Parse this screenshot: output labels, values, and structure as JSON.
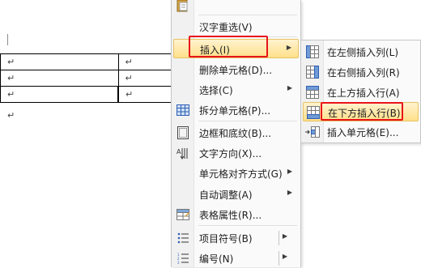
{
  "document": {
    "paragraph_mark": "↵",
    "rows": [
      [
        "↵",
        "↵"
      ],
      [
        "↵",
        "↵"
      ],
      [
        "↵",
        "↵"
      ]
    ],
    "after_table_mark": "↵"
  },
  "context_menu": {
    "items": [
      {
        "label": "",
        "icon": "paste-icon"
      },
      {
        "label": "汉字重选(V)",
        "icon": ""
      },
      {
        "label": "插入(I)",
        "icon": "",
        "submenu": true,
        "highlighted": true
      },
      {
        "label": "删除单元格(D)...",
        "icon": ""
      },
      {
        "label": "选择(C)",
        "icon": "",
        "submenu": true
      },
      {
        "label": "拆分单元格(P)...",
        "icon": "split-cells-icon"
      },
      {
        "label": "边框和底纹(B)...",
        "icon": "borders-icon"
      },
      {
        "label": "文字方向(X)...",
        "icon": "text-direction-icon"
      },
      {
        "label": "单元格对齐方式(G)",
        "icon": "",
        "submenu": true
      },
      {
        "label": "自动调整(A)",
        "icon": "",
        "submenu": true
      },
      {
        "label": "表格属性(R)...",
        "icon": "table-properties-icon"
      },
      {
        "label": "项目符号(B)",
        "icon": "bullets-icon",
        "submenu": true
      },
      {
        "label": "编号(N)",
        "icon": "numbering-icon",
        "submenu": true
      }
    ]
  },
  "insert_submenu": {
    "items": [
      {
        "label": "在左侧插入列(L)",
        "icon": "insert-column-left-icon"
      },
      {
        "label": "在右侧插入列(R)",
        "icon": "insert-column-right-icon"
      },
      {
        "label": "在上方插入行(A)",
        "icon": "insert-row-above-icon"
      },
      {
        "label": "在下方插入行(B)",
        "icon": "insert-row-below-icon",
        "highlighted": true
      },
      {
        "label": "插入单元格(E)...",
        "icon": "insert-cells-icon"
      }
    ]
  },
  "colors": {
    "highlight_top": "#fff3cf",
    "highlight_bottom": "#ffe08a",
    "annotation_red": "#e8141b",
    "icon_blue": "#2f5fb3"
  }
}
